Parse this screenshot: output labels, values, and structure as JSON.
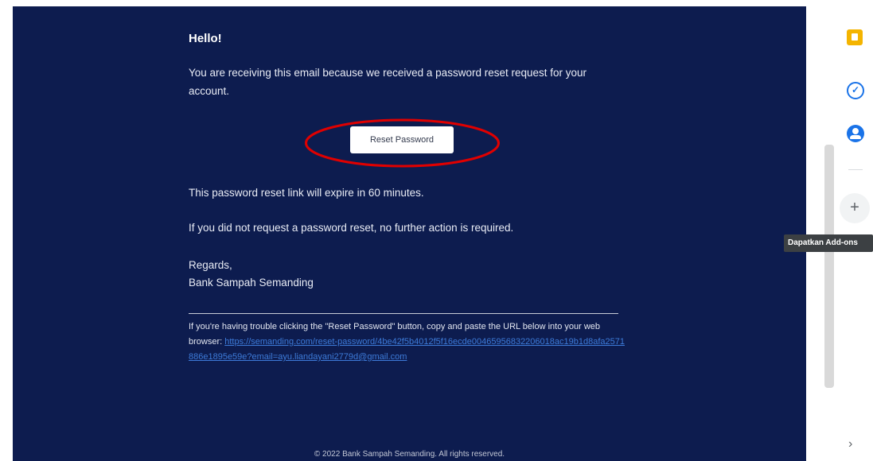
{
  "email": {
    "greeting": "Hello!",
    "intro": "You are receiving this email because we received a password reset request for your account.",
    "button_label": "Reset Password",
    "expire_note": "This password reset link will expire in 60 minutes.",
    "no_action_note": "If you did not request a password reset, no further action is required.",
    "regards": "Regards,",
    "sender": "Bank Sampah Semanding",
    "subcopy_text": "If you're having trouble clicking the \"Reset Password\" button, copy and paste the URL below into your web browser:",
    "reset_url": "https://semanding.com/reset-password/4be42f5b4012f5f16ecde00465956832206018ac19b1d8afa2571886e1895e59e?email=ayu.liandayani2779d@gmail.com",
    "footer": "© 2022 Bank Sampah Semanding. All rights reserved."
  },
  "side_panel": {
    "tasks_glyph": "✓",
    "add_glyph": "+",
    "tooltip": "Dapatkan Add-ons",
    "chevron_glyph": "›"
  },
  "colors": {
    "email_background": "#0d1c4f",
    "link": "#3d7bd9",
    "highlight": "#e00000"
  }
}
